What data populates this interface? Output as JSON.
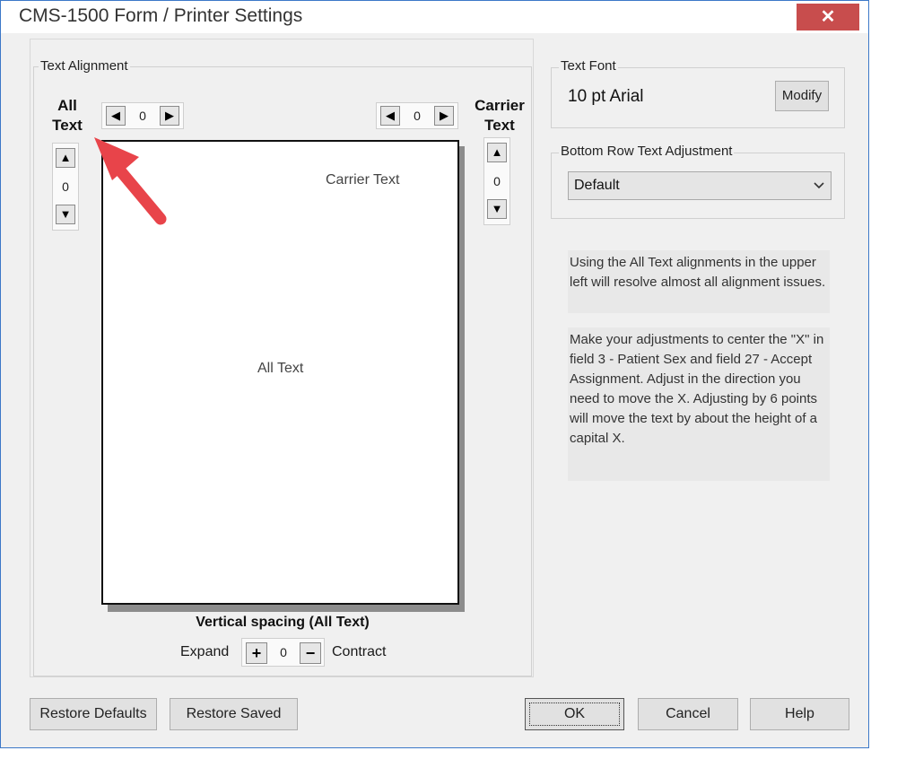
{
  "window": {
    "title": "CMS-1500 Form / Printer Settings",
    "close_glyph": "✕"
  },
  "text_alignment": {
    "legend": "Text Alignment",
    "all_text_label_line1": "All",
    "all_text_label_line2": "Text",
    "carrier_text_label_line1": "Carrier",
    "carrier_text_label_line2": "Text",
    "all_text_horizontal_value": "0",
    "carrier_text_horizontal_value": "0",
    "all_text_vertical_value": "0",
    "carrier_text_vertical_value": "0",
    "preview_carrier_text": "Carrier Text",
    "preview_all_text": "All Text",
    "vertical_spacing_label": "Vertical spacing (All Text)",
    "expand_label": "Expand",
    "contract_label": "Contract",
    "vertical_spacing_value": "0"
  },
  "text_font": {
    "legend": "Text Font",
    "value": "10 pt  Arial",
    "modify_label": "Modify"
  },
  "bottom_row": {
    "legend": "Bottom Row Text Adjustment",
    "selected": "Default"
  },
  "info": {
    "para1": "Using the All Text alignments in the upper left will resolve almost all alignment issues.",
    "para2": "Make your adjustments to center the \"X\" in field 3 - Patient Sex and field 27 - Accept Assignment. Adjust in the direction you need to move the X. Adjusting by 6 points will move the text by about the height of a capital X."
  },
  "buttons": {
    "restore_defaults": "Restore Defaults",
    "restore_saved": "Restore Saved",
    "ok": "OK",
    "cancel": "Cancel",
    "help": "Help"
  },
  "colors": {
    "close_button": "#c84d4d",
    "annotation_arrow": "#e8444a",
    "window_border": "#3c78c8"
  }
}
